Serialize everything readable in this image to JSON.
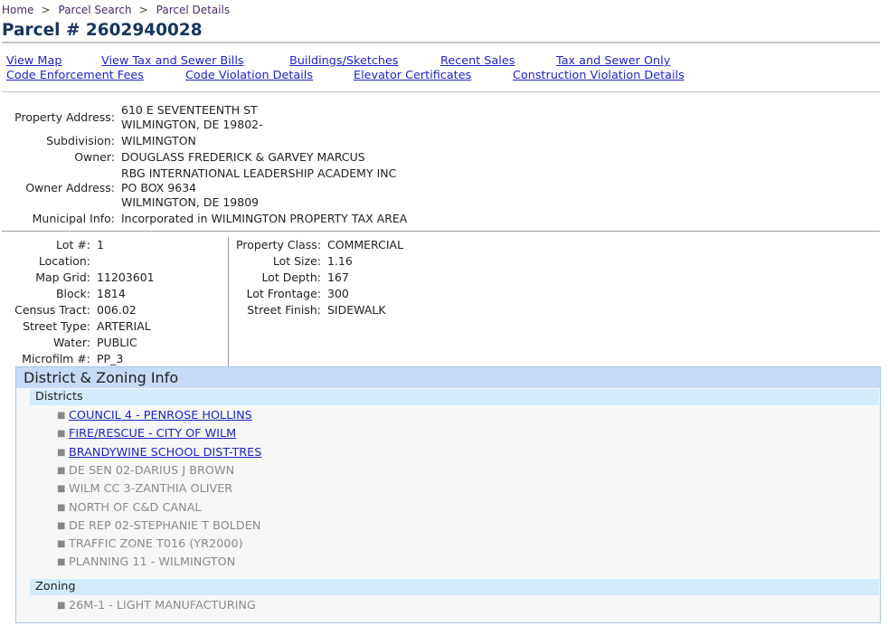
{
  "breadcrumb": {
    "home": "Home",
    "search": "Parcel Search",
    "current": "Parcel Details",
    "sep": ">"
  },
  "title": "Parcel # 2602940028",
  "nav": {
    "row1": [
      "View Map",
      "View Tax and Sewer Bills",
      "Buildings/Sketches",
      "Recent Sales",
      "Tax and Sewer Only"
    ],
    "row2": [
      "Code Enforcement Fees",
      "Code Violation Details",
      "Elevator Certificates",
      "Construction Violation Details"
    ]
  },
  "property": {
    "address_label": "Property Address:",
    "address_line1": "610 E SEVENTEENTH ST",
    "address_line2": "WILMINGTON, DE 19802-",
    "subdivision_label": "Subdivision:",
    "subdivision": "WILMINGTON",
    "owner_label": "Owner:",
    "owner_line1": "DOUGLASS FREDERICK & GARVEY MARCUS",
    "owner_line2": "RBG INTERNATIONAL LEADERSHIP ACADEMY INC",
    "owner_address_label": "Owner Address:",
    "owner_address_line1": "PO BOX 9634",
    "owner_address_line2": "WILMINGTON, DE 19809",
    "municipal_label": "Municipal Info:",
    "municipal": "Incorporated in WILMINGTON PROPERTY TAX AREA"
  },
  "details_left": [
    {
      "label": "Lot #:",
      "value": "1"
    },
    {
      "label": "Location:",
      "value": ""
    },
    {
      "label": "Map Grid:",
      "value": "11203601"
    },
    {
      "label": "Block:",
      "value": "1814"
    },
    {
      "label": "Census Tract:",
      "value": "006.02"
    },
    {
      "label": "Street Type:",
      "value": "ARTERIAL"
    },
    {
      "label": "Water:",
      "value": "PUBLIC"
    },
    {
      "label": "Microfilm #:",
      "value": "PP_3"
    }
  ],
  "details_right": [
    {
      "label": "Property Class:",
      "value": "COMMERCIAL"
    },
    {
      "label": "Lot Size:",
      "value": "1.16"
    },
    {
      "label": "Lot Depth:",
      "value": "167"
    },
    {
      "label": "Lot Frontage:",
      "value": "300"
    },
    {
      "label": "Street Finish:",
      "value": "SIDEWALK"
    }
  ],
  "zoning_panel": {
    "title": "District & Zoning Info",
    "districts_label": "Districts",
    "districts": [
      {
        "text": "COUNCIL 4 - PENROSE HOLLINS",
        "link": true
      },
      {
        "text": "FIRE/RESCUE - CITY OF WILM",
        "link": true
      },
      {
        "text": "BRANDYWINE SCHOOL DIST-TRES",
        "link": true
      },
      {
        "text": "DE SEN 02-DARIUS J BROWN",
        "link": false
      },
      {
        "text": "WILM CC 3-ZANTHIA OLIVER",
        "link": false
      },
      {
        "text": "NORTH OF C&D CANAL",
        "link": false
      },
      {
        "text": "DE REP 02-STEPHANIE T BOLDEN",
        "link": false
      },
      {
        "text": "TRAFFIC ZONE T016 (YR2000)",
        "link": false
      },
      {
        "text": "PLANNING 11 - WILMINGTON",
        "link": false
      }
    ],
    "zoning_label": "Zoning",
    "zoning": [
      {
        "text": "26M-1 - LIGHT MANUFACTURING",
        "link": false
      }
    ]
  },
  "icons": {
    "bullet": "square-bullet-icon"
  }
}
